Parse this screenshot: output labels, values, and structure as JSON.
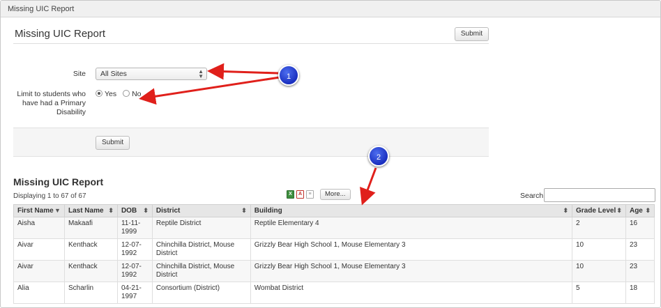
{
  "window": {
    "title": "Missing UIC Report"
  },
  "panel": {
    "title": "Missing UIC Report",
    "submit_top_label": "Submit",
    "site_label": "Site",
    "site_value": "All Sites",
    "limit_label_line1": "Limit to students who",
    "limit_label_line2": "have had a Primary",
    "limit_label_line3": "Disability",
    "radio_yes": "Yes",
    "radio_no": "No",
    "submit_bottom_label": "Submit"
  },
  "report": {
    "title": "Missing UIC Report",
    "display_info": "Displaying 1 to 67 of 67",
    "more_label": "More...",
    "search_label": "Search",
    "columns": [
      "First Name",
      "Last Name",
      "DOB",
      "District",
      "Building",
      "Grade Level",
      "Age"
    ],
    "rows": [
      [
        "Aisha",
        "Makaafi",
        "11-11-\n1999",
        "Reptile District",
        "Reptile Elementary 4",
        "2",
        "16"
      ],
      [
        "Aivar",
        "Kenthack",
        "12-07-\n1992",
        "Chinchilla District, Mouse\nDistrict",
        "Grizzly Bear High School 1, Mouse Elementary 3",
        "10",
        "23"
      ],
      [
        "Aivar",
        "Kenthack",
        "12-07-\n1992",
        "Chinchilla District, Mouse\nDistrict",
        "Grizzly Bear High School 1, Mouse Elementary 3",
        "10",
        "23"
      ],
      [
        "Alia",
        "Scharlin",
        "04-21-\n1997",
        "Consortium (District)",
        "Wombat District",
        "5",
        "18"
      ]
    ]
  },
  "annotations": {
    "badge1": "1",
    "badge2": "2"
  },
  "colors": {
    "arrow": "#e0201b",
    "badge": "#1a2fbf"
  }
}
